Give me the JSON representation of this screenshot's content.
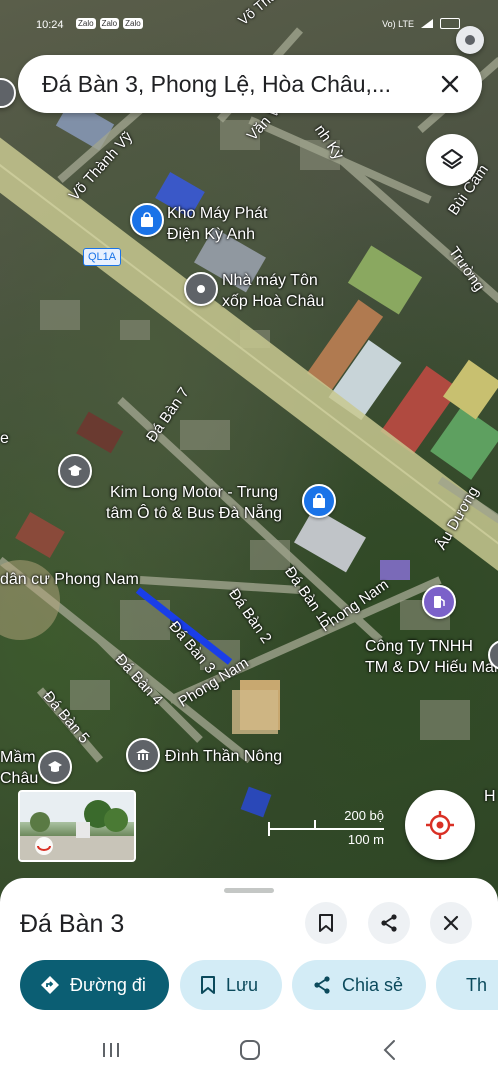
{
  "status_bar": {
    "time": "10:24",
    "apps": [
      "Zalo",
      "Zalo",
      "Zalo"
    ],
    "network": "Vo) LTE"
  },
  "search": {
    "query": "Đá Bàn 3, Phong Lệ, Hòa Châu,..."
  },
  "map": {
    "road_labels": {
      "vo_thanh_vy": "Võ Thành Vỹ",
      "van_vinh": "Văn Vĩnh",
      "nh_ky": "nh Kỳ",
      "bui_cam": "Bùi Cẩm",
      "truong": "Trường",
      "da_ban_7": "Đá Bàn 7",
      "da_ban_1": "Đá Bàn 1",
      "da_ban_2": "Đá Bàn 2",
      "da_ban_3": "Đá Bàn 3",
      "da_ban_4": "Đá Bàn 4",
      "da_ban_5": "Đá Bàn 5",
      "phong_nam_1": "Phong Nam",
      "phong_nam_2": "Phong Nam",
      "au_duong": "Âu Dương",
      "vo_thanh_top": "Võ Thành"
    },
    "route_shield": "QL1A",
    "places": {
      "kho_may": "Kho Máy Phát\nĐiện Kỳ Anh",
      "nha_may": "Nhà máy Tôn\nxốp Hoà Châu",
      "kim_long": "Kim Long Motor - Trung\ntâm Ô tô & Bus Đà Nẵng",
      "khu_dan_cu": "dân cư Phong Nam",
      "cong_ty": "Công Ty TNHH\nTM & DV Hiếu Mai",
      "dinh": "Đình Thần Nông",
      "mam_chau": "Mầm\nChâu",
      "edge_e": "e",
      "edge_h": "H"
    },
    "scale": {
      "imperial": "200 bộ",
      "metric": "100 m"
    },
    "colors": {
      "selected_road": "#1a3ee8",
      "pin_blue": "#1a73e8",
      "pin_gray": "#5f6368",
      "pin_purple": "#7b61c9"
    }
  },
  "sheet": {
    "title": "Đá Bàn 3",
    "chips": {
      "directions": "Đường đi",
      "save": "Lưu",
      "share": "Chia sẻ",
      "more": "Th"
    }
  }
}
